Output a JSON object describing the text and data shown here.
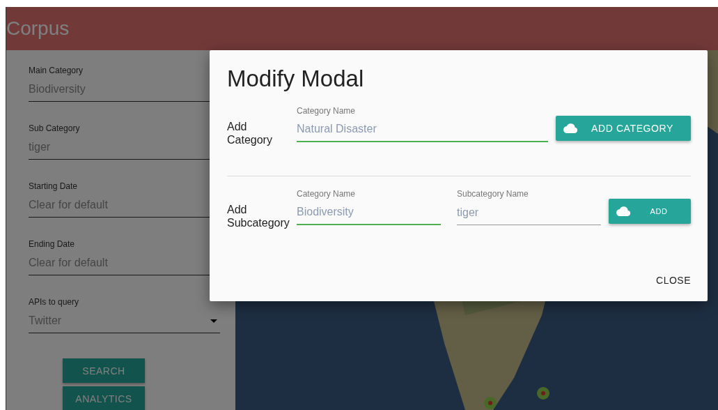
{
  "header": {
    "title": "Corpus"
  },
  "sidebar": {
    "fields": [
      {
        "label": "Main Category",
        "placeholder": "Biodiversity",
        "kind": "select"
      },
      {
        "label": "Sub Category",
        "placeholder": "tiger",
        "kind": "select"
      },
      {
        "label": "Starting Date",
        "placeholder": "Clear for default",
        "kind": "text"
      },
      {
        "label": "Ending Date",
        "placeholder": "Clear for default",
        "kind": "text"
      },
      {
        "label": "APIs to query",
        "placeholder": "Twitter",
        "kind": "select"
      }
    ],
    "buttons": [
      "SEARCH",
      "ANALYTICS"
    ]
  },
  "modal": {
    "title": "Modify Modal",
    "sections": [
      {
        "label": "Add Category",
        "fields": [
          {
            "label": "Category Name",
            "placeholder": "Natural Disaster",
            "highlighted": true
          }
        ],
        "button": "ADD CATEGORY"
      },
      {
        "label": "Add Subcategory",
        "fields": [
          {
            "label": "Category Name",
            "placeholder": "Biodiversity",
            "highlighted": true
          },
          {
            "label": "Subcategory Name",
            "placeholder": "tiger",
            "highlighted": false
          }
        ],
        "button": "ADD"
      }
    ],
    "close": "CLOSE"
  }
}
